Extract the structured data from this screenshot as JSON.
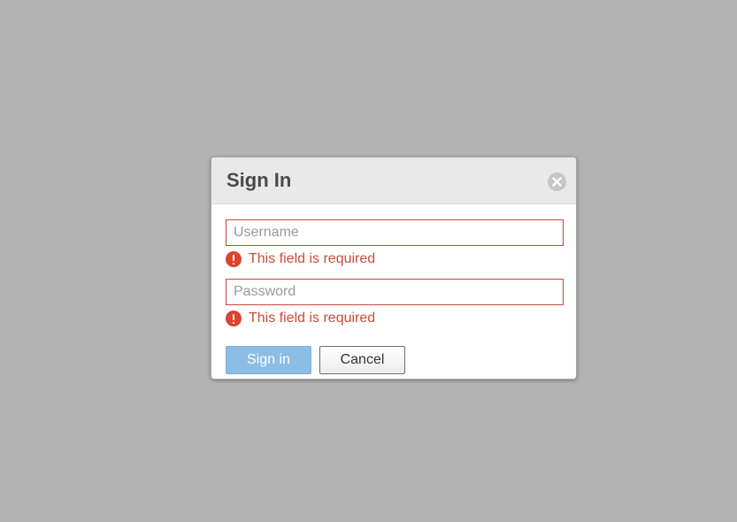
{
  "dialog": {
    "title": "Sign In",
    "close_icon": "close-circle-icon"
  },
  "form": {
    "username": {
      "value": "",
      "placeholder": "Username",
      "error": "This field is required"
    },
    "password": {
      "value": "",
      "placeholder": "Password",
      "error": "This field is required"
    },
    "error_icon": "exclamation-circle-icon"
  },
  "actions": {
    "sign_in_label": "Sign in",
    "cancel_label": "Cancel"
  },
  "colors": {
    "backdrop": "#b3b3b3",
    "error": "#cd4b37",
    "primary_button": "#8cbde4",
    "header_bg": "#e9e9e9"
  }
}
